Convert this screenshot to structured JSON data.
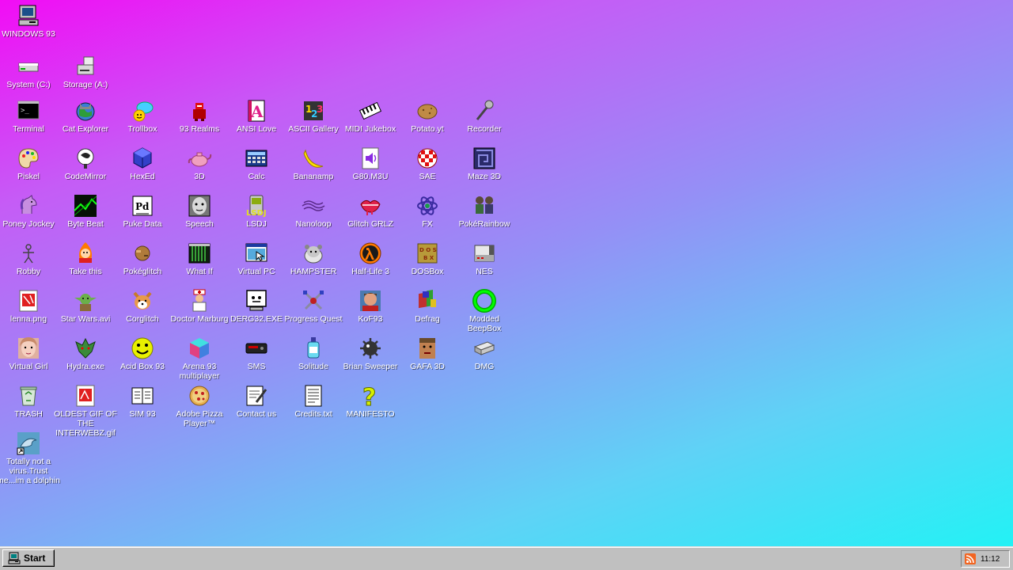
{
  "desktop": {
    "icons": [
      {
        "id": "windows-93",
        "label": "WINDOWS 93",
        "icon": "computer-icon"
      },
      {
        "id": "system-c",
        "label": "System (C:)",
        "icon": "hard-drive-icon"
      },
      {
        "id": "storage-a",
        "label": "Storage (A:)",
        "icon": "storage-drive-icon"
      },
      {
        "id": "terminal",
        "label": "Terminal",
        "icon": "terminal-icon"
      },
      {
        "id": "cat-explorer",
        "label": "Cat Explorer",
        "icon": "globe-cat-icon"
      },
      {
        "id": "trollbox",
        "label": "Trollbox",
        "icon": "chat-bubble-icon"
      },
      {
        "id": "93-realms",
        "label": "93 Realms",
        "icon": "red-knight-icon"
      },
      {
        "id": "ansi-love",
        "label": "ANSI Love",
        "icon": "letter-a-icon"
      },
      {
        "id": "ascii-gallery",
        "label": "ASCII Gallery",
        "icon": "number-blocks-icon"
      },
      {
        "id": "midi-jukebox",
        "label": "MIDI Jukebox",
        "icon": "piano-keys-icon"
      },
      {
        "id": "potato-yt",
        "label": "Potato.yt",
        "icon": "potato-icon"
      },
      {
        "id": "recorder",
        "label": "Recorder",
        "icon": "microphone-icon"
      },
      {
        "id": "piskel",
        "label": "Piskel",
        "icon": "palette-icon"
      },
      {
        "id": "codemirror",
        "label": "CodeMirror",
        "icon": "mirror-icon"
      },
      {
        "id": "hexed",
        "label": "HexEd",
        "icon": "hex-cube-icon"
      },
      {
        "id": "3d",
        "label": "3D",
        "icon": "teapot-icon"
      },
      {
        "id": "calc",
        "label": "Calc",
        "icon": "calculator-icon"
      },
      {
        "id": "bananamp",
        "label": "Bananamp",
        "icon": "banana-icon"
      },
      {
        "id": "g80m3u",
        "label": "G80.M3U",
        "icon": "speaker-icon"
      },
      {
        "id": "sae",
        "label": "SAE",
        "icon": "checkered-ball-icon"
      },
      {
        "id": "maze-3d",
        "label": "Maze 3D",
        "icon": "maze-icon"
      },
      {
        "id": "poney-jockey",
        "label": "Poney Jockey",
        "icon": "pony-icon"
      },
      {
        "id": "byte-beat",
        "label": "Byte Beat",
        "icon": "waveform-icon"
      },
      {
        "id": "puke-data",
        "label": "Puke Data",
        "icon": "pd-icon"
      },
      {
        "id": "speech",
        "label": "Speech",
        "icon": "face-icon"
      },
      {
        "id": "lsdj",
        "label": "LSDJ",
        "icon": "gameboy-icon"
      },
      {
        "id": "nanoloop",
        "label": "Nanoloop",
        "icon": "wave-lines-icon"
      },
      {
        "id": "glitch-grlz",
        "label": "Glitch GRLZ",
        "icon": "lips-icon"
      },
      {
        "id": "fx",
        "label": "FX",
        "icon": "atom-icon"
      },
      {
        "id": "pokerainbow",
        "label": "PokéRainbow",
        "icon": "trainers-icon"
      },
      {
        "id": "robby",
        "label": "Robby",
        "icon": "stick-figure-icon"
      },
      {
        "id": "take-this",
        "label": "Take this",
        "icon": "fire-character-icon"
      },
      {
        "id": "pokeglitch",
        "label": "Pokéglitch",
        "icon": "glitch-ball-icon"
      },
      {
        "id": "what-if",
        "label": "What If",
        "icon": "matrix-screen-icon"
      },
      {
        "id": "virtual-pc",
        "label": "Virtual PC",
        "icon": "window-cursor-icon"
      },
      {
        "id": "hampster",
        "label": "HAMPSTER",
        "icon": "hamster-icon"
      },
      {
        "id": "half-life-3",
        "label": "Half-Life 3",
        "icon": "lambda-icon"
      },
      {
        "id": "dosbox",
        "label": "DOSBox",
        "icon": "dosbox-icon"
      },
      {
        "id": "nes",
        "label": "NES",
        "icon": "nes-console-icon"
      },
      {
        "id": "lenna-png",
        "label": "lenna.png",
        "icon": "image-file-icon"
      },
      {
        "id": "star-wars-avi",
        "label": "Star Wars.avi",
        "icon": "yoda-icon"
      },
      {
        "id": "corglitch",
        "label": "Corglitch",
        "icon": "corgi-icon"
      },
      {
        "id": "doctor-marburg",
        "label": "Doctor Marburg",
        "icon": "doctor-icon"
      },
      {
        "id": "derg32-exe",
        "label": "DERG32.EXE",
        "icon": "monitor-face-icon"
      },
      {
        "id": "progress-quest",
        "label": "Progress Quest",
        "icon": "crossed-swords-icon"
      },
      {
        "id": "kof93",
        "label": "KoF93",
        "icon": "fighter-portrait-icon"
      },
      {
        "id": "defrag",
        "label": "Defrag",
        "icon": "defrag-blocks-icon"
      },
      {
        "id": "modded-beepbox",
        "label": "Modded BeepBox",
        "icon": "green-ring-icon"
      },
      {
        "id": "virtual-girl",
        "label": "Virtual Girl",
        "icon": "girl-face-icon"
      },
      {
        "id": "hydra-exe",
        "label": "Hydra.exe",
        "icon": "hydra-icon"
      },
      {
        "id": "acid-box-93",
        "label": "Acid Box 93",
        "icon": "smiley-icon"
      },
      {
        "id": "arena-93",
        "label": "Arena 93 multiplayer",
        "icon": "rgb-cube-icon"
      },
      {
        "id": "sms",
        "label": "SMS",
        "icon": "sega-console-icon"
      },
      {
        "id": "solitude",
        "label": "Solitude",
        "icon": "bottle-icon"
      },
      {
        "id": "brian-sweeper",
        "label": "Brian Sweeper",
        "icon": "mine-icon"
      },
      {
        "id": "gafa-3d",
        "label": "GAFA 3D",
        "icon": "soldier-face-icon"
      },
      {
        "id": "dmg",
        "label": "DMG",
        "icon": "disk-drive-icon"
      },
      {
        "id": "trash",
        "label": "TRASH",
        "icon": "recycle-bin-icon"
      },
      {
        "id": "oldest-gif",
        "label": "OLDEST GIF OF THE INTERWEBZ.gif",
        "icon": "gif-file-icon"
      },
      {
        "id": "sim-93",
        "label": "SIM 93",
        "icon": "book-icon"
      },
      {
        "id": "adobe-pizza",
        "label": "Adobe Pizza Player™",
        "icon": "pizza-icon"
      },
      {
        "id": "contact-us",
        "label": "Contact us",
        "icon": "note-pen-icon"
      },
      {
        "id": "credits-txt",
        "label": "Credits.txt",
        "icon": "text-file-icon"
      },
      {
        "id": "manifesto",
        "label": "MANIFESTO",
        "icon": "question-mark-icon"
      },
      {
        "id": "dolphin",
        "label": "Totally not a virus.Trust me...im a dolphin",
        "icon": "dolphin-shortcut-icon"
      }
    ]
  },
  "taskbar": {
    "start_label": "Start",
    "start_icon": "start-computer-icon",
    "tray_icon": "rss-feed-icon",
    "clock": "11:12"
  },
  "colors": {
    "bg_top_left": "#f20cf5",
    "bg_bottom_right": "#1cf5f5",
    "taskbar": "#c0c0c0",
    "label": "#ffffff",
    "tray_rss": "#f26522"
  }
}
